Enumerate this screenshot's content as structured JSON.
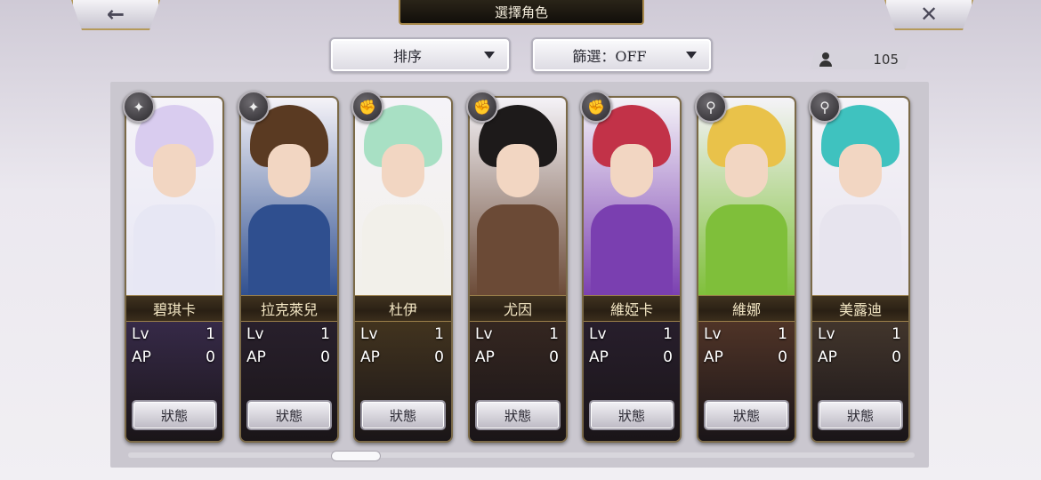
{
  "header": {
    "title": "選擇角色",
    "back_icon": "←",
    "close_icon": "✕"
  },
  "controls": {
    "sort_label": "排序",
    "filter_label": "篩選：OFF",
    "count": "105"
  },
  "cards": [
    {
      "name": "碧琪卡",
      "lv_label": "Lv",
      "lv": "1",
      "ap_label": "AP",
      "ap": "0",
      "status": "狀態",
      "badge_icon": "✦",
      "colors": {
        "hair": "#d9ccef",
        "body": "#e7e7f4",
        "lower": "#3c2e52"
      }
    },
    {
      "name": "拉克萊兒",
      "lv_label": "Lv",
      "lv": "1",
      "ap_label": "AP",
      "ap": "0",
      "status": "狀態",
      "badge_icon": "✦",
      "colors": {
        "hair": "#5a3a22",
        "body": "#2f4f8f",
        "lower": "#2b2230"
      }
    },
    {
      "name": "杜伊",
      "lv_label": "Lv",
      "lv": "1",
      "ap_label": "AP",
      "ap": "0",
      "status": "狀態",
      "badge_icon": "✊",
      "colors": {
        "hair": "#a8e0c4",
        "body": "#f2f0ea",
        "lower": "#4a3a20"
      }
    },
    {
      "name": "尤因",
      "lv_label": "Lv",
      "lv": "1",
      "ap_label": "AP",
      "ap": "0",
      "status": "狀態",
      "badge_icon": "✊",
      "colors": {
        "hair": "#1d1a1a",
        "body": "#6b4a36",
        "lower": "#3a2a22"
      }
    },
    {
      "name": "維婭卡",
      "lv_label": "Lv",
      "lv": "1",
      "ap_label": "AP",
      "ap": "0",
      "status": "狀態",
      "badge_icon": "✊",
      "colors": {
        "hair": "#c23248",
        "body": "#7a3fb0",
        "lower": "#2a2030"
      }
    },
    {
      "name": "維娜",
      "lv_label": "Lv",
      "lv": "1",
      "ap_label": "AP",
      "ap": "0",
      "status": "狀態",
      "badge_icon": "⚲",
      "colors": {
        "hair": "#e9c24a",
        "body": "#7fbf3a",
        "lower": "#5a3a2a"
      }
    },
    {
      "name": "美露迪",
      "lv_label": "Lv",
      "lv": "1",
      "ap_label": "AP",
      "ap": "0",
      "status": "狀態",
      "badge_icon": "⚲",
      "colors": {
        "hair": "#3fc2bf",
        "body": "#e7e4ee",
        "lower": "#4a3c30"
      }
    }
  ]
}
